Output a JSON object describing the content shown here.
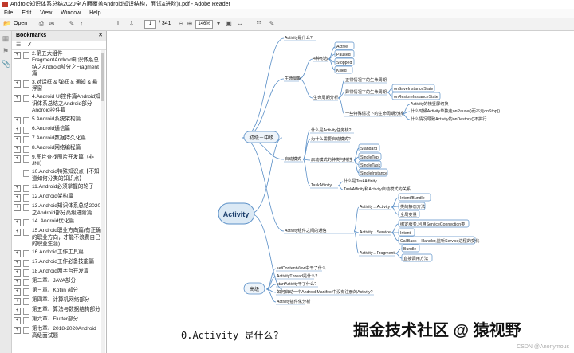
{
  "window": {
    "title": "Android知识体系总结2020全方面覆盖Android知识结构，面试&进阶)).pdf - Adobe Reader"
  },
  "menu": [
    "File",
    "Edit",
    "View",
    "Window",
    "Help"
  ],
  "toolbar": {
    "open_label": "Open",
    "page_current": "1",
    "page_total": "/ 341",
    "zoom": "146%",
    "right_edge": "To"
  },
  "bookmarks": {
    "title": "Bookmarks",
    "items": [
      {
        "label": "2.第五大组件 FragmentAndroid知识体系总结之Android部分之Fragment篇",
        "expandable": true
      },
      {
        "label": "3.对话框 & 弹框 & 通知 & 悬浮窗",
        "expandable": true
      },
      {
        "label": "4.Android UI控件篇Android知识体系总结之Android部分Android控件篇",
        "expandable": true
      },
      {
        "label": "5.Android系统架构篇",
        "expandable": true
      },
      {
        "label": "6.Android通信篇",
        "expandable": true
      },
      {
        "label": "7.Android数据持久化篇",
        "expandable": true
      },
      {
        "label": "8.Android网络编程篇",
        "expandable": true
      },
      {
        "label": "9.图片查找图片开发篇（非JNI）",
        "expandable": true
      },
      {
        "label": "10.Android特殊知识点【不知道如何分类的知识点】",
        "expandable": false
      },
      {
        "label": "11.Android必须掌握的轮子",
        "expandable": true
      },
      {
        "label": "12.Android架构篇",
        "expandable": true
      },
      {
        "label": "13.Android知识体系总结2020之Android部分高级进阶篇",
        "expandable": true
      },
      {
        "label": "14. Android优化篇",
        "expandable": true
      },
      {
        "label": "15.Android职业方向篇(有正确的职业方向，才能不浪费自己的职业生涯)",
        "expandable": true
      },
      {
        "label": "16.Android工作工具篇",
        "expandable": true
      },
      {
        "label": "17.Android工作必备技能篇",
        "expandable": true
      },
      {
        "label": "18.Android两字台开发篇",
        "expandable": true
      },
      {
        "label": "第二章、JAVA部分",
        "expandable": true
      },
      {
        "label": "第三章、Kotlin 部分",
        "expandable": true
      },
      {
        "label": "第四章、计算机网络部分",
        "expandable": true
      },
      {
        "label": "第五章、算法与数据结构部分",
        "expandable": true
      },
      {
        "label": "第六章、Flutter部分",
        "expandable": true
      },
      {
        "label": "第七章、2018-2020Android高级面试题",
        "expandable": true
      }
    ]
  },
  "mindmap": {
    "root": "Activity",
    "junior": "初级－中级",
    "senior": "高级",
    "what": "Activity是什么?",
    "lifecycle": "生命周期",
    "states": "4种形态",
    "active": "Active",
    "paused": "Paused",
    "stopped": "Stopped",
    "killed": "Killed",
    "lc_analysis": "生命周期分析",
    "normal_lc": "正常情况下的生命周期",
    "abnormal_lc": "异常情况下的生命周期",
    "save_state": "onSaveInstanceState",
    "restore_state": "onRestoreInstanceState",
    "special_lc": "一些特殊情况下的生命周期分析",
    "switch_lc": "Activity的横竖屏切换",
    "onpause_stop": "什么时候Activity单独走onPause()而不走onStop()",
    "ondestroy": "什么情况导致Activity的onDestory()不执行",
    "launch_mode": "启动模式",
    "task_stack": "什么是Activity任务栈?",
    "why_mode": "为什么需要启动模式?",
    "four_modes": "启动模式的种类与特性",
    "standard": "Standard",
    "singletop": "SingleTop",
    "singletask": "SingleTask",
    "singleinstance": "SingleInstance",
    "task_affinity": "TaskAffinity",
    "what_affinity": "什么是TaskAffinity",
    "affinity_rel": "TaskAffinity和Activity启动模式的关系",
    "comm": "Activity组件之间的通信",
    "a2a": "Activity→Activity",
    "intent_bundle": "Intent/Bundle",
    "class_static": "类的静态方法",
    "global_var": "全局变量",
    "a2s": "Activity→Service",
    "bind_service": "绑定服务,利用ServiceConnection类",
    "intent": "Intent",
    "callback": "CallBack + Handler,监听Service进程的变化",
    "a2f": "Activity→Fragment",
    "bundle": "Bundle",
    "direct_call": "直接调用方法",
    "set_view": "setContentView中干了什么",
    "thread": "ActivityThread是什么?",
    "start_act": "startActivity干了什么?",
    "manifest": "如何启动一个Android Manifest中没有注册的Activity?",
    "plugin": "Activity插件化分析"
  },
  "caption": "0.Activity 是什么?",
  "watermark": "掘金技术社区 @ 猿视野",
  "csdn": "CSDN @Anonymous"
}
